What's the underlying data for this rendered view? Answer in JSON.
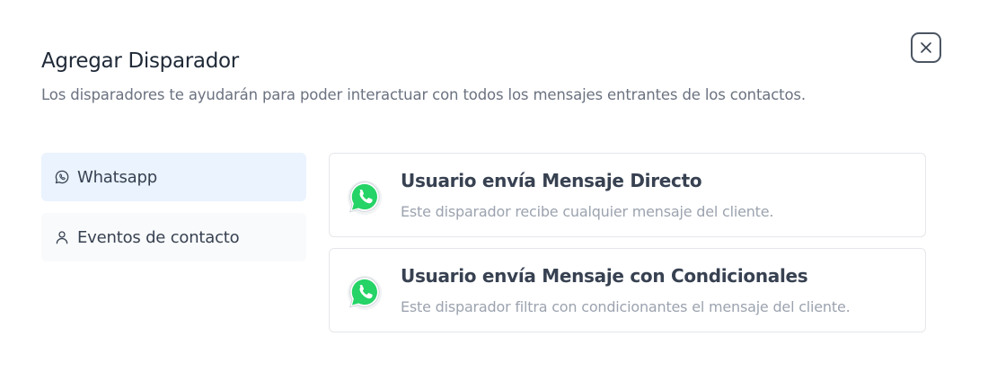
{
  "modal": {
    "title": "Agregar Disparador",
    "subtitle": "Los disparadores te ayudarán para poder interactuar con todos los mensajes entrantes de los contactos."
  },
  "nav": {
    "items": [
      {
        "label": "Whatsapp",
        "icon": "whatsapp-outline-icon",
        "active": true
      },
      {
        "label": "Eventos de contacto",
        "icon": "user-icon",
        "active": false
      }
    ]
  },
  "triggers": [
    {
      "title": "Usuario envía Mensaje Directo",
      "description": "Este disparador recibe cualquier mensaje del cliente.",
      "icon": "whatsapp-logo-icon"
    },
    {
      "title": "Usuario envía Mensaje con Condicionales",
      "description": "Este disparador filtra con condicionantes el mensaje del cliente.",
      "icon": "whatsapp-logo-icon"
    }
  ],
  "colors": {
    "accent_bg": "#eaf3fe",
    "whatsapp_green": "#25d366"
  }
}
